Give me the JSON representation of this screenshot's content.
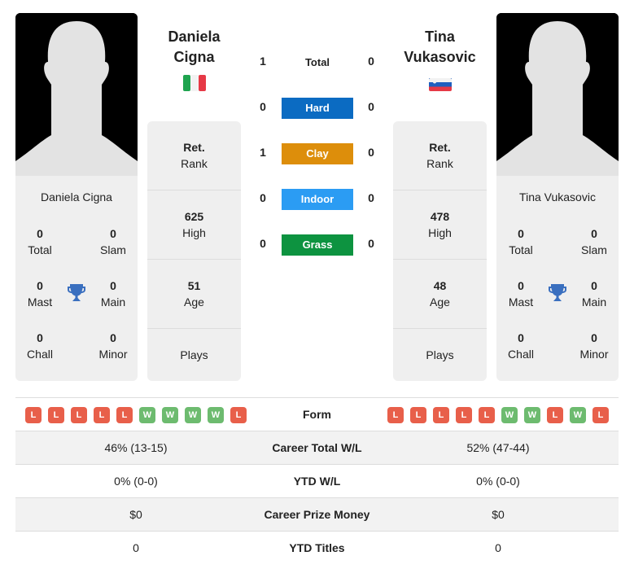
{
  "player1": {
    "name_line1": "Daniela",
    "name_line2": "Cigna",
    "full_name": "Daniela Cigna",
    "country_flag": "italy-flag",
    "titles": {
      "total": "0",
      "total_label": "Total",
      "slam": "0",
      "slam_label": "Slam",
      "mast": "0",
      "mast_label": "Mast",
      "main": "0",
      "main_label": "Main",
      "chall": "0",
      "chall_label": "Chall",
      "minor": "0",
      "minor_label": "Minor"
    },
    "info": {
      "rank_value": "Ret.",
      "rank_label": "Rank",
      "high_value": "625",
      "high_label": "High",
      "age_value": "51",
      "age_label": "Age",
      "plays_label": "Plays"
    },
    "form": [
      "L",
      "L",
      "L",
      "L",
      "L",
      "W",
      "W",
      "W",
      "W",
      "L"
    ],
    "career_total_wl": "46% (13-15)",
    "ytd_wl": "0% (0-0)",
    "career_prize_money": "$0",
    "ytd_titles": "0"
  },
  "player2": {
    "name_line1": "Tina",
    "name_line2": "Vukasovic",
    "full_name": "Tina Vukasovic",
    "country_flag": "slovenia-flag",
    "titles": {
      "total": "0",
      "total_label": "Total",
      "slam": "0",
      "slam_label": "Slam",
      "mast": "0",
      "mast_label": "Mast",
      "main": "0",
      "main_label": "Main",
      "chall": "0",
      "chall_label": "Chall",
      "minor": "0",
      "minor_label": "Minor"
    },
    "info": {
      "rank_value": "Ret.",
      "rank_label": "Rank",
      "high_value": "478",
      "high_label": "High",
      "age_value": "48",
      "age_label": "Age",
      "plays_label": "Plays"
    },
    "form": [
      "L",
      "L",
      "L",
      "L",
      "L",
      "W",
      "W",
      "L",
      "W",
      "L"
    ],
    "career_total_wl": "52% (47-44)",
    "ytd_wl": "0% (0-0)",
    "career_prize_money": "$0",
    "ytd_titles": "0"
  },
  "h2h": {
    "total_label": "Total",
    "total_p1": "1",
    "total_p2": "0",
    "surfaces": [
      {
        "label": "Hard",
        "p1": "0",
        "p2": "0",
        "color": "#0b6bc2"
      },
      {
        "label": "Clay",
        "p1": "1",
        "p2": "0",
        "color": "#dd8e0b"
      },
      {
        "label": "Indoor",
        "p1": "0",
        "p2": "0",
        "color": "#2b9cf3"
      },
      {
        "label": "Grass",
        "p1": "0",
        "p2": "0",
        "color": "#0d9340"
      }
    ]
  },
  "comparison": {
    "form_label": "Form",
    "career_total_wl_label": "Career Total W/L",
    "ytd_wl_label": "YTD W/L",
    "career_prize_money_label": "Career Prize Money",
    "ytd_titles_label": "YTD Titles"
  },
  "colors": {
    "loss": "#e85f4a",
    "win": "#6dbb6f",
    "trophy": "#3a6fbf"
  }
}
